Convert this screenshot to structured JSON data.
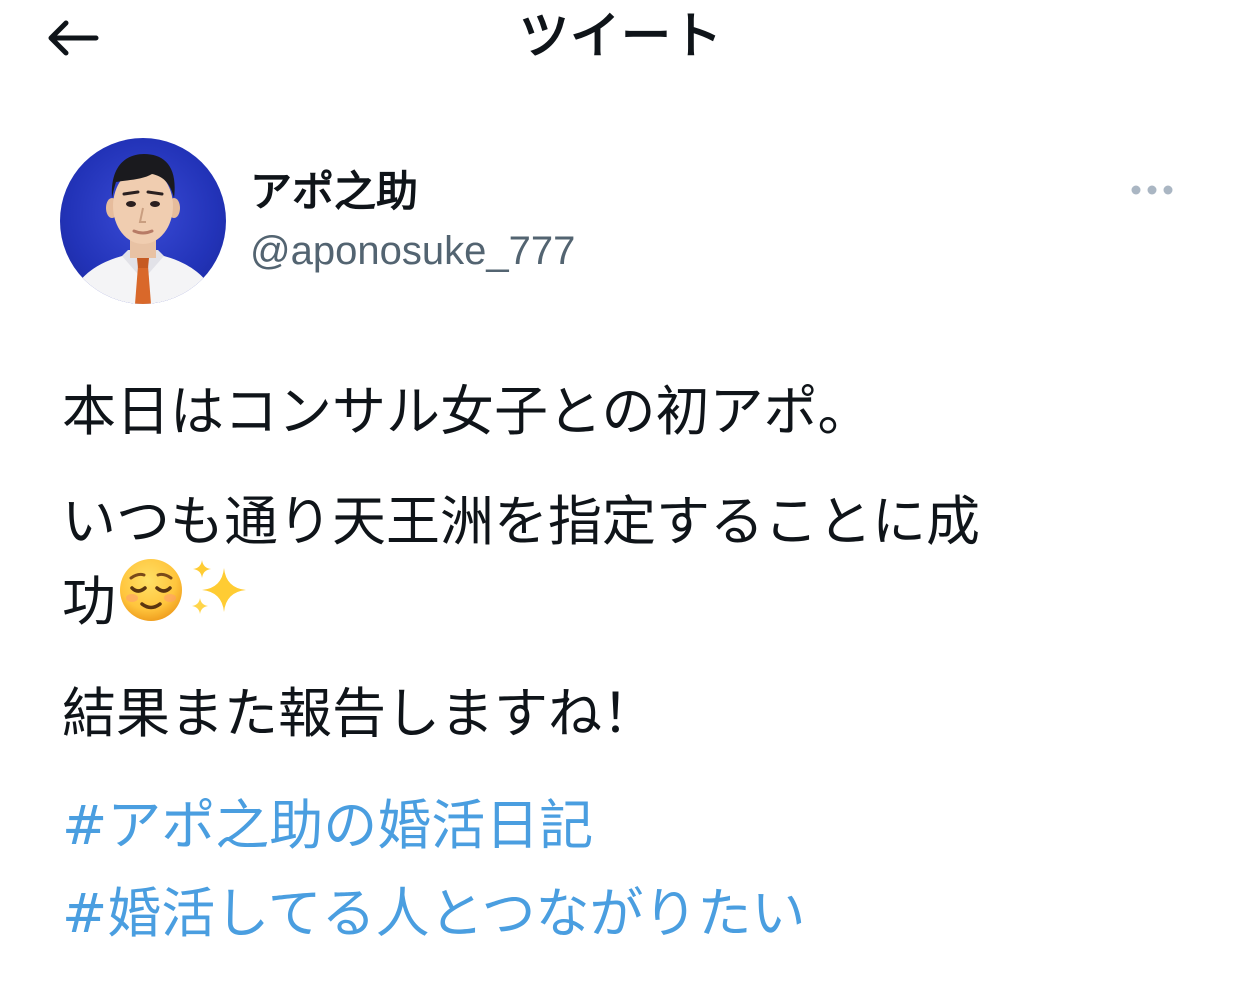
{
  "header": {
    "title": "ツイート",
    "back_icon": "back-arrow-icon"
  },
  "author": {
    "display_name": "アポ之助",
    "handle": "@aponosuke_777",
    "avatar_icon": "avatar-illustration",
    "more_icon": "more-dots-icon"
  },
  "tweet": {
    "line1": "本日はコンサル女子との初アポ。",
    "line2": "いつも通り天王洲を指定することに成",
    "line3": "功",
    "line4": "結果また報告しますね！",
    "emojis": [
      "relieved-face-icon",
      "sparkles-icon"
    ],
    "hashtags": [
      "#アポ之助の婚活日記",
      "#婚活してる人とつながりたい"
    ]
  },
  "colors": {
    "text": "#0f1419",
    "secondary": "#536471",
    "link": "#4a9ee0",
    "avatar_bg": "#2233b8"
  }
}
